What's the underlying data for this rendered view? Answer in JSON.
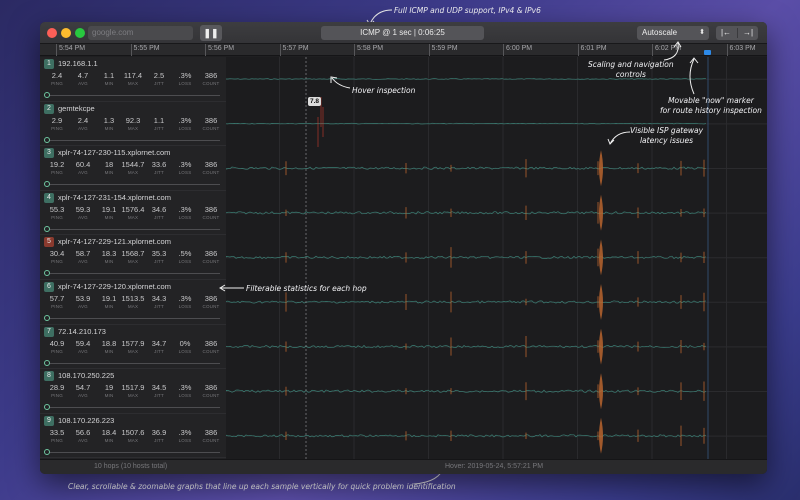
{
  "annotations": {
    "top": "Full ICMP and UDP support, IPv4 & IPv6",
    "scaling": "Scaling and navigation\ncontrols",
    "hover": "Hover inspection",
    "now_marker": "Movable \"now\" marker\nfor route history inspection",
    "isp": "Visible ISP gateway\nlatency issues",
    "stats": "Filterable statistics for each hop",
    "bottom": "Clear, scrollable & zoomable graphs that line up each sample vertically for quick problem identification"
  },
  "toolbar": {
    "search_placeholder": "google.com",
    "pause_label": "❚❚",
    "status_text": "ICMP @ 1 sec  |  0:06:25",
    "autoscale_label": "Autoscale",
    "autoscale_chevron": "⬍",
    "nav_back": "|←",
    "nav_forward": "→|"
  },
  "time_ticks": [
    "5:54 PM",
    "5:55 PM",
    "5:56 PM",
    "5:57 PM",
    "5:58 PM",
    "5:59 PM",
    "6:00 PM",
    "6:01 PM",
    "6:02 PM",
    "6:03 PM"
  ],
  "stat_labels": [
    "PING",
    "AVG",
    "MIN",
    "MAX",
    "JITT",
    "LOSS",
    "COUNT"
  ],
  "hops": [
    {
      "num": "1",
      "name": "192.168.1.1",
      "warn": false,
      "stats": [
        "2.4",
        "4.7",
        "1.1",
        "117.4",
        "2.5",
        ".3%",
        "386"
      ]
    },
    {
      "num": "2",
      "name": "gemtekcpe",
      "warn": false,
      "stats": [
        "2.9",
        "2.4",
        "1.3",
        "92.3",
        "1.1",
        ".3%",
        "386"
      ]
    },
    {
      "num": "3",
      "name": "xplr-74-127-230-115.xplornet.com",
      "warn": false,
      "stats": [
        "19.2",
        "60.4",
        "18",
        "1544.7",
        "33.6",
        ".3%",
        "386"
      ]
    },
    {
      "num": "4",
      "name": "xplr-74-127-231-154.xplornet.com",
      "warn": false,
      "stats": [
        "55.3",
        "59.3",
        "19.1",
        "1576.4",
        "34.6",
        ".3%",
        "386"
      ]
    },
    {
      "num": "5",
      "name": "xplr-74-127-229-121.xplornet.com",
      "warn": true,
      "stats": [
        "30.4",
        "58.7",
        "18.3",
        "1568.7",
        "35.3",
        ".5%",
        "386"
      ]
    },
    {
      "num": "6",
      "name": "xplr-74-127-229-120.xplornet.com",
      "warn": false,
      "stats": [
        "57.7",
        "53.9",
        "19.1",
        "1513.5",
        "34.3",
        ".3%",
        "386"
      ]
    },
    {
      "num": "7",
      "name": "72.14.210.173",
      "warn": false,
      "stats": [
        "40.9",
        "59.4",
        "18.8",
        "1577.9",
        "34.7",
        "0%",
        "386"
      ]
    },
    {
      "num": "8",
      "name": "108.170.250.225",
      "warn": false,
      "stats": [
        "28.9",
        "54.7",
        "19",
        "1517.9",
        "34.5",
        ".3%",
        "386"
      ]
    },
    {
      "num": "9",
      "name": "108.170.226.223",
      "warn": false,
      "stats": [
        "33.5",
        "56.6",
        "18.4",
        "1507.6",
        "36.9",
        ".3%",
        "386"
      ]
    }
  ],
  "hover_value": "7.8",
  "status_bar": {
    "left": "10 hops (10 hosts total)",
    "right": "Hover: 2019-05-24, 5:57:21 PM"
  },
  "colors": {
    "signal": "#3f8f82",
    "spike": "#b8642e",
    "loss": "#c0392b",
    "now_marker": "#2d8ae8"
  }
}
